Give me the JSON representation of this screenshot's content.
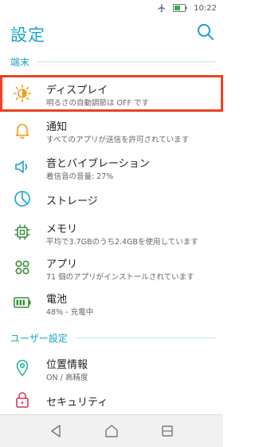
{
  "status_bar": {
    "time": "10:22",
    "icons": [
      "airplane-icon",
      "battery-icon"
    ]
  },
  "header": {
    "title": "設定",
    "search_icon": "search-icon"
  },
  "colors": {
    "accent": "#1aa3c8",
    "selection_outline": "#e84324"
  },
  "sections": [
    {
      "label": "端末",
      "items": [
        {
          "title": "ディスプレイ",
          "subtitle": "明るさの自動調節は OFF です",
          "icon": "brightness-icon",
          "selected": true
        },
        {
          "title": "通知",
          "subtitle": "すべてのアプリが送信を許可されています",
          "icon": "bell-icon"
        },
        {
          "title": "音とバイブレーション",
          "subtitle": "着信音の音量: 27%",
          "icon": "speaker-icon"
        },
        {
          "title": "ストレージ",
          "subtitle": "",
          "icon": "storage-icon"
        },
        {
          "title": "メモリ",
          "subtitle": "平均で3.7GBのうち2.4GBを使用しています",
          "icon": "memory-chip-icon"
        },
        {
          "title": "アプリ",
          "subtitle": "71 個のアプリがインストールされています",
          "icon": "apps-icon"
        },
        {
          "title": "電池",
          "subtitle": "48% - 充電中",
          "icon": "battery-charging-icon"
        }
      ]
    },
    {
      "label": "ユーザー設定",
      "items": [
        {
          "title": "位置情報",
          "subtitle": "ON / 高精度",
          "icon": "location-icon"
        },
        {
          "title": "セキュリティ",
          "subtitle": "",
          "icon": "lock-icon"
        }
      ]
    }
  ],
  "nav": [
    "back-icon",
    "home-icon",
    "recents-icon"
  ]
}
